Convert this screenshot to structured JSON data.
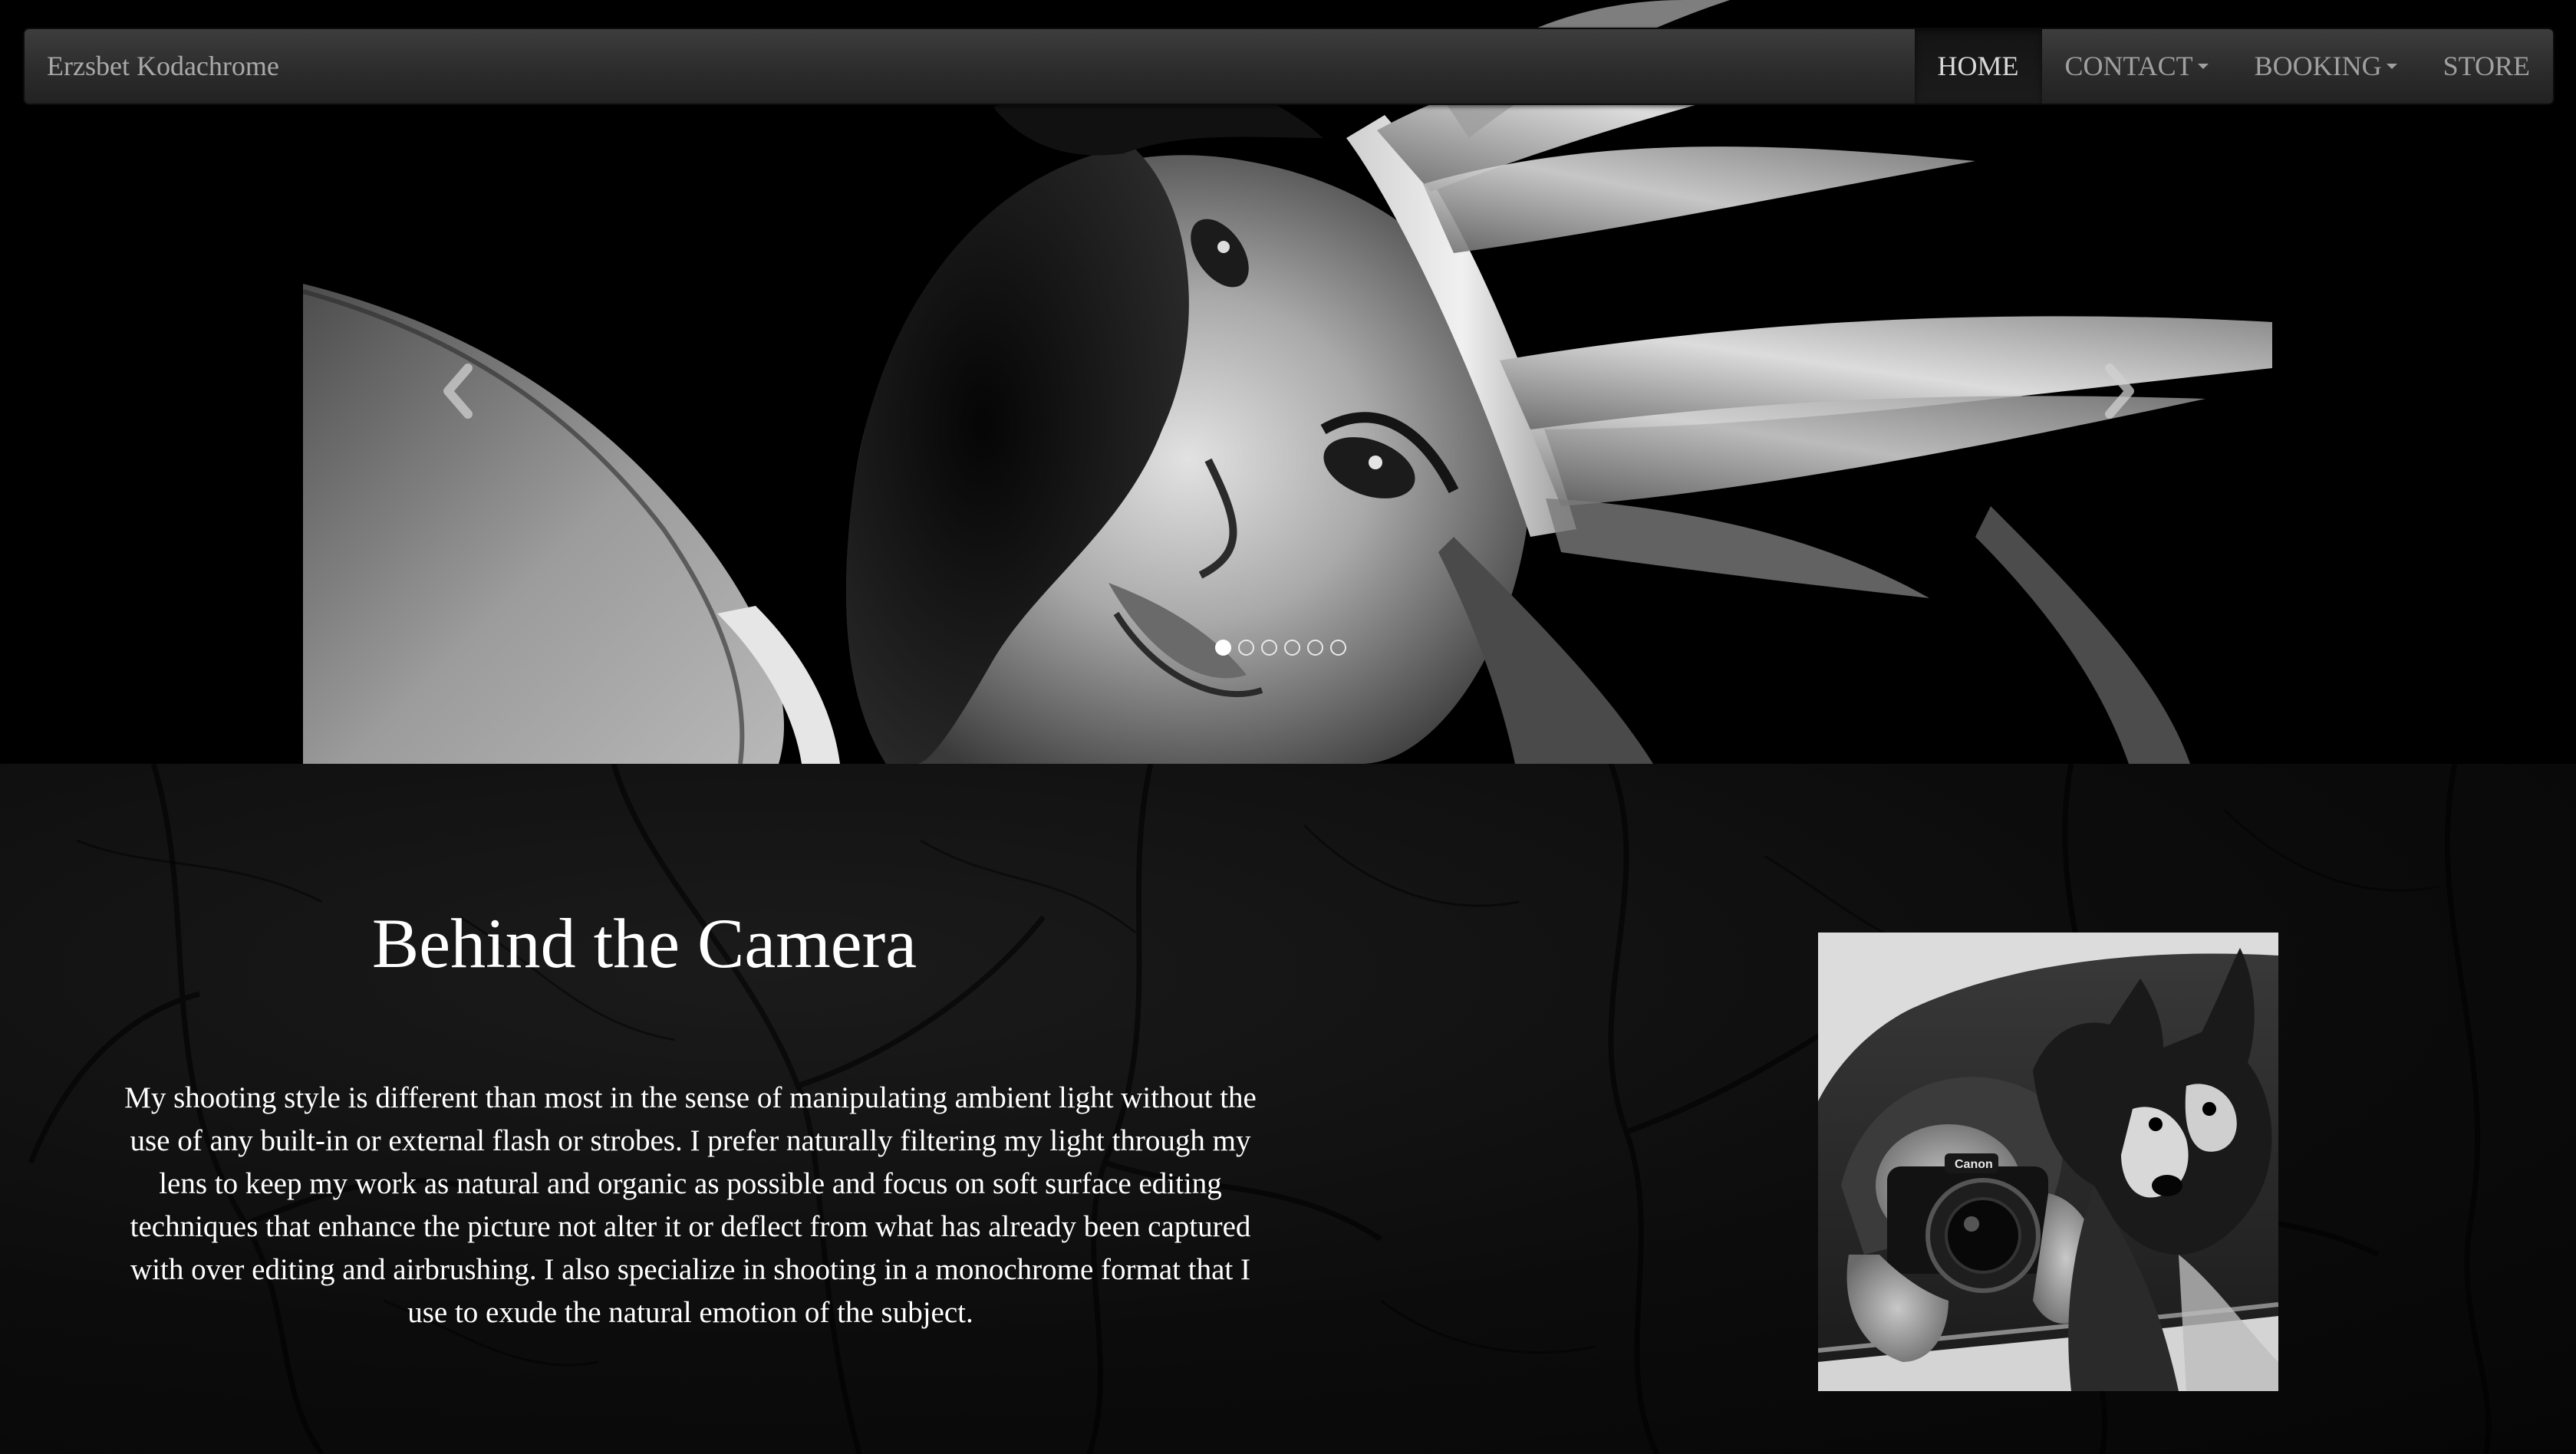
{
  "navbar": {
    "brand": "Erzsbet Kodachrome",
    "items": [
      {
        "label": "HOME",
        "active": true,
        "dropdown": false
      },
      {
        "label": "CONTACT",
        "active": false,
        "dropdown": true
      },
      {
        "label": "BOOKING",
        "active": false,
        "dropdown": true
      },
      {
        "label": "STORE",
        "active": false,
        "dropdown": false
      }
    ]
  },
  "carousel": {
    "slide_count": 6,
    "active_slide": 1,
    "prev_icon": "chevron-left-icon",
    "next_icon": "chevron-right-icon"
  },
  "about": {
    "title": "Behind the Camera",
    "text": "My shooting style is different than most in the sense of manipulating ambient light without the use of any built-in or external flash or strobes. I prefer naturally filtering my light through my lens to keep my work as natural and organic as possible and focus on soft surface editing techniques that enhance the picture not alter it or deflect from what has already been captured with over editing and airbrushing. I also specialize in shooting in a monochrome format that I use to exude the natural emotion of the subject.",
    "camera_brand": "Canon"
  },
  "colors": {
    "background": "#000000",
    "navbar_top": "#3d3d3d",
    "navbar_bottom": "#222222",
    "nav_text": "#a0a0a0",
    "text": "#ffffff"
  }
}
